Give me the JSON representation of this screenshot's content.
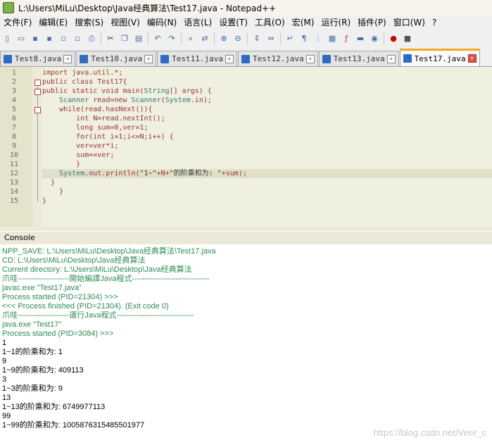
{
  "window": {
    "title": "L:\\Users\\MiLu\\Desktop\\Java经典算法\\Test17.java - Notepad++"
  },
  "menu": [
    "文件(F)",
    "编辑(E)",
    "搜索(S)",
    "视图(V)",
    "编码(N)",
    "语言(L)",
    "设置(T)",
    "工具(O)",
    "宏(M)",
    "运行(R)",
    "插件(P)",
    "窗口(W)",
    "?"
  ],
  "toolbar_icons": [
    "new-file-icon",
    "open-file-icon",
    "save-icon",
    "save-all-icon",
    "close-icon",
    "close-all-icon",
    "print-icon",
    "cut-icon",
    "copy-icon",
    "paste-icon",
    "undo-icon",
    "redo-icon",
    "find-icon",
    "replace-icon",
    "zoom-in-icon",
    "zoom-out-icon",
    "sync-v-icon",
    "sync-h-icon",
    "word-wrap-icon",
    "show-all-chars-icon",
    "indent-guide-icon",
    "doc-map-icon",
    "function-list-icon",
    "folder-workspace-icon",
    "monitor-icon",
    "record-macro-icon",
    "stop-record-icon"
  ],
  "tabs": [
    {
      "label": "Test8.java",
      "active": false
    },
    {
      "label": "Test10.java",
      "active": false
    },
    {
      "label": "Test11.java",
      "active": false
    },
    {
      "label": "Test12.java",
      "active": false
    },
    {
      "label": "Test13.java",
      "active": false
    },
    {
      "label": "Test17.java",
      "active": true
    }
  ],
  "code_lines": [
    "import java.util.*;",
    "public class Test17{",
    "public static void main(String[] args) {",
    "    Scanner read=new Scanner(System.in);",
    "    while(read.hasNext()){",
    "        int N=read.nextInt();",
    "        long sum=0,ver=1;",
    "        for(int i=1;i<=N;i++) {",
    "        ver=ver*i;",
    "        sum+=ver;",
    "        }",
    "    System.out.println(\"1~\"+N+\"的阶乘和为: \"+sum);",
    "  }",
    "    }",
    "}"
  ],
  "line_numbers": [
    "1",
    "2",
    "3",
    "4",
    "5",
    "6",
    "7",
    "8",
    "9",
    "10",
    "11",
    "12",
    "13",
    "14",
    "15"
  ],
  "current_line": 12,
  "console_title": "Console",
  "console_lines": [
    {
      "text": "NPP_SAVE: L:\\Users\\MiLu\\Desktop\\Java经典算法\\Test17.java",
      "color": "g"
    },
    {
      "text": "CD: L:\\Users\\MiLu\\Desktop\\Java经典算法",
      "color": "g"
    },
    {
      "text": "Current directory: L:\\Users\\MiLu\\Desktop\\Java经典算法",
      "color": "g"
    },
    {
      "text": "爪哇--------------------開始編譯Java程式------------------------------",
      "color": "g"
    },
    {
      "text": "javac.exe \"Test17.java\"",
      "color": "g"
    },
    {
      "text": "Process started (PID=21304) >>>",
      "color": "g"
    },
    {
      "text": "<<< Process finished (PID=21304). (Exit code 0)",
      "color": "g"
    },
    {
      "text": "爪哇--------------------運行Java程式------------------------------",
      "color": "g"
    },
    {
      "text": "java.exe \"Test17\"",
      "color": "g"
    },
    {
      "text": "Process started (PID=3084) >>>",
      "color": "g"
    },
    {
      "text": "1",
      "color": "b"
    },
    {
      "text": "1~1的阶乘和为: 1",
      "color": "b"
    },
    {
      "text": "9",
      "color": "b"
    },
    {
      "text": "1~9的阶乘和为: 409113",
      "color": "b"
    },
    {
      "text": "3",
      "color": "b"
    },
    {
      "text": "1~3的阶乘和为: 9",
      "color": "b"
    },
    {
      "text": "13",
      "color": "b"
    },
    {
      "text": "1~13的阶乘和为: 6749977113",
      "color": "b"
    },
    {
      "text": "99",
      "color": "b"
    },
    {
      "text": "1~99的阶乘和为: 1005876315485501977",
      "color": "b"
    }
  ],
  "watermark": "https://blog.csdn.net/Veer_c"
}
